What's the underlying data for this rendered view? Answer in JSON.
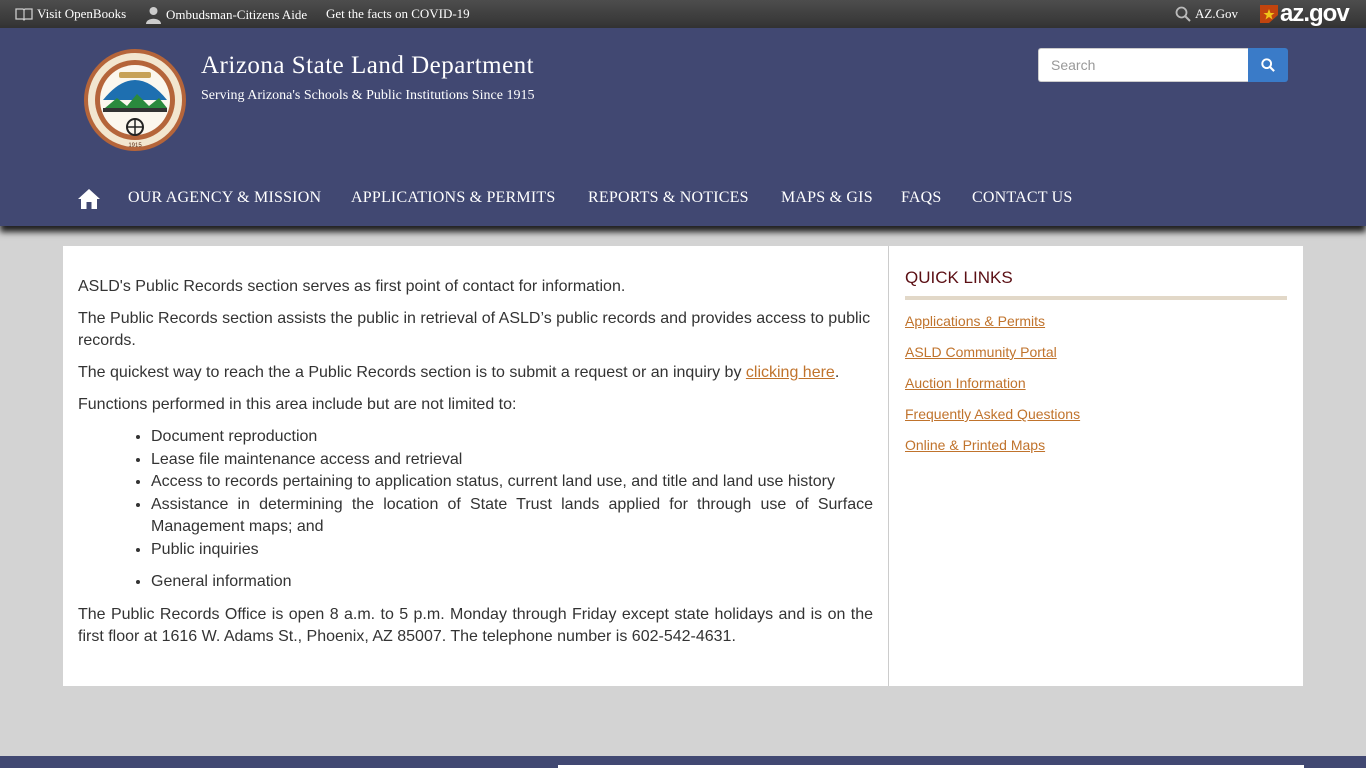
{
  "topbar": {
    "openbooks": "Visit OpenBooks",
    "ombudsman": "Ombudsman-Citizens Aide",
    "covid": "Get the facts on COVID-19",
    "azgov_link": "AZ.Gov",
    "azgov_logo": "az.gov"
  },
  "header": {
    "title": "Arizona State Land Department",
    "subtitle": "Serving Arizona's Schools & Public Institutions Since 1915",
    "search_placeholder": "Search",
    "seal_year": "1915"
  },
  "nav": {
    "items": [
      "OUR AGENCY & MISSION",
      "APPLICATIONS & PERMITS",
      "REPORTS & NOTICES",
      "MAPS & GIS",
      "FAQS",
      "CONTACT US"
    ]
  },
  "main": {
    "p1": "ASLD's Public Records section serves as first point of contact for information.",
    "p2": "The Public Records section assists the public in retrieval of ASLD’s public records and provides access to public records.",
    "p3_before": "The quickest way to reach the a Public Records section is to submit a request or an inquiry by ",
    "p3_link": "clicking here",
    "p3_after": ".",
    "p4": "Functions performed in this area include but are not limited to:",
    "list": [
      "Document reproduction",
      "Lease file maintenance access and retrieval",
      "Access to records pertaining to application status, current land use, and title and land use history",
      "Assistance in determining the location of State Trust lands applied for through use of Surface Management maps; and",
      "Public inquiries"
    ],
    "list2": [
      "General information"
    ],
    "p5": "The Public Records Office is open 8 a.m. to 5 p.m. Monday through Friday except state holidays and is on the first floor at 1616 W. Adams St., Phoenix, AZ 85007. The telephone number is 602-542-4631."
  },
  "sidebar": {
    "heading": "QUICK LINKS",
    "links": [
      "Applications & Permits",
      "ASLD Community Portal",
      "Auction Information",
      "Frequently Asked Questions",
      "Online & Printed Maps"
    ]
  },
  "colors": {
    "header_bg": "#414872",
    "link": "#c0732c",
    "quicklinks_heading": "#5b0f14",
    "search_button": "#3a7bc8"
  },
  "icons": [
    "book-icon",
    "person-icon",
    "search-icon",
    "home-icon",
    "arizona-flag-icon"
  ]
}
